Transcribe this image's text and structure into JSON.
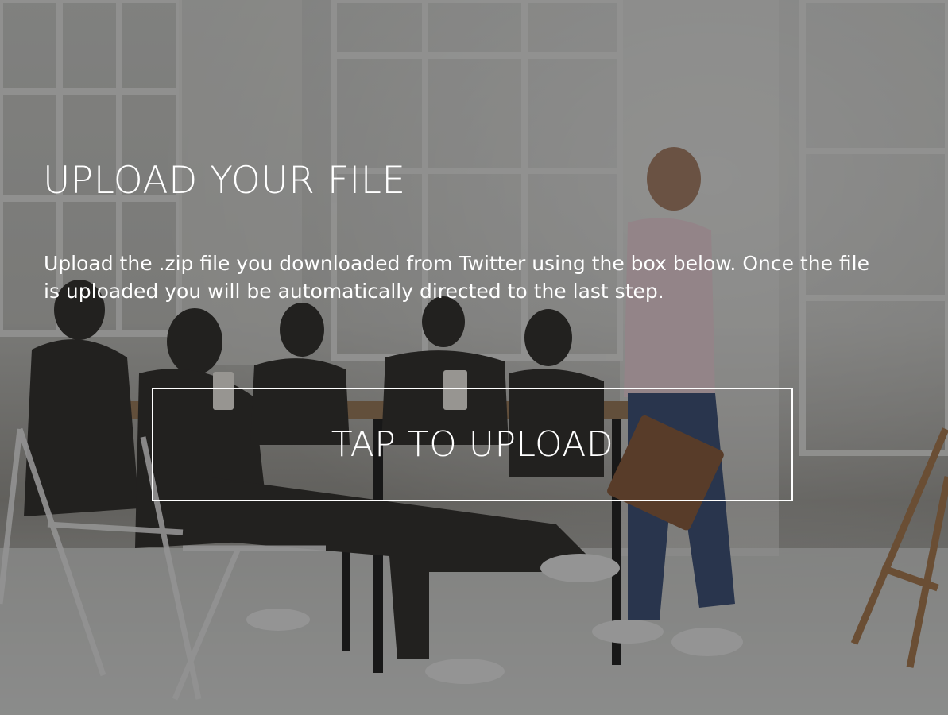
{
  "page": {
    "title": "UPLOAD YOUR FILE",
    "instructions": "Upload the .zip file you downloaded from Twitter using the box below. Once the file is uploaded you will be automatically directed to the last step."
  },
  "upload": {
    "label": "TAP TO UPLOAD"
  },
  "colors": {
    "text": "#ffffff",
    "overlay": "#141414",
    "box_border": "#ffffff"
  },
  "background": {
    "subject": "people-meeting-office-photo"
  }
}
